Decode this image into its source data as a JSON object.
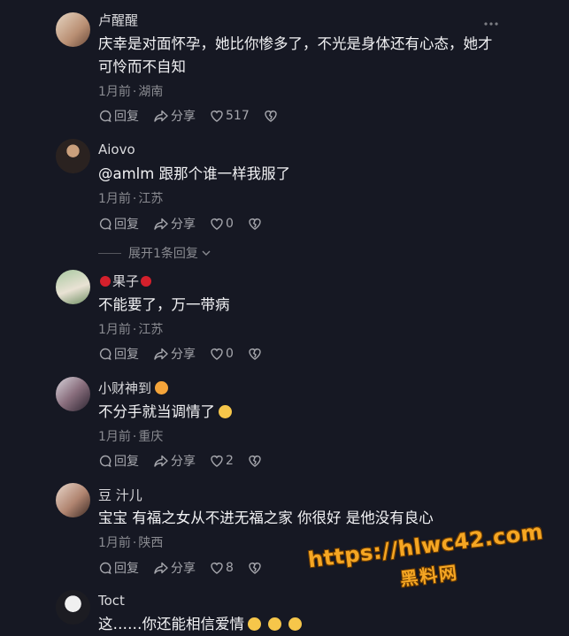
{
  "comments": [
    {
      "username": "卢醒醒",
      "text": "庆幸是对面怀孕，她比你惨多了，不光是身体还有心态，她才可怜而不自知",
      "time": "1月前",
      "location": "湖南",
      "reply": "回复",
      "share": "分享",
      "likes": "517"
    },
    {
      "username": "Aiovo",
      "text": "@amlm 跟那个谁一样我服了",
      "time": "1月前",
      "location": "江苏",
      "reply": "回复",
      "share": "分享",
      "likes": "0",
      "expand_replies": "展开1条回复"
    },
    {
      "username": "果子",
      "text": "不能要了，万一带病",
      "time": "1月前",
      "location": "江苏",
      "reply": "回复",
      "share": "分享",
      "likes": "0"
    },
    {
      "username": "小财神到",
      "text": "不分手就当调情了",
      "time": "1月前",
      "location": "重庆",
      "reply": "回复",
      "share": "分享",
      "likes": "2"
    },
    {
      "username": "豆 汁儿",
      "text": "宝宝 有福之女从不进无福之家 你很好 是他没有良心",
      "time": "1月前",
      "location": "陕西",
      "reply": "回复",
      "share": "分享",
      "likes": "8"
    },
    {
      "username": "Toct",
      "text": "这……你还能相信爱情"
    }
  ],
  "watermark": {
    "line1": "https://hlwc42.com",
    "line2": "黑料网"
  }
}
